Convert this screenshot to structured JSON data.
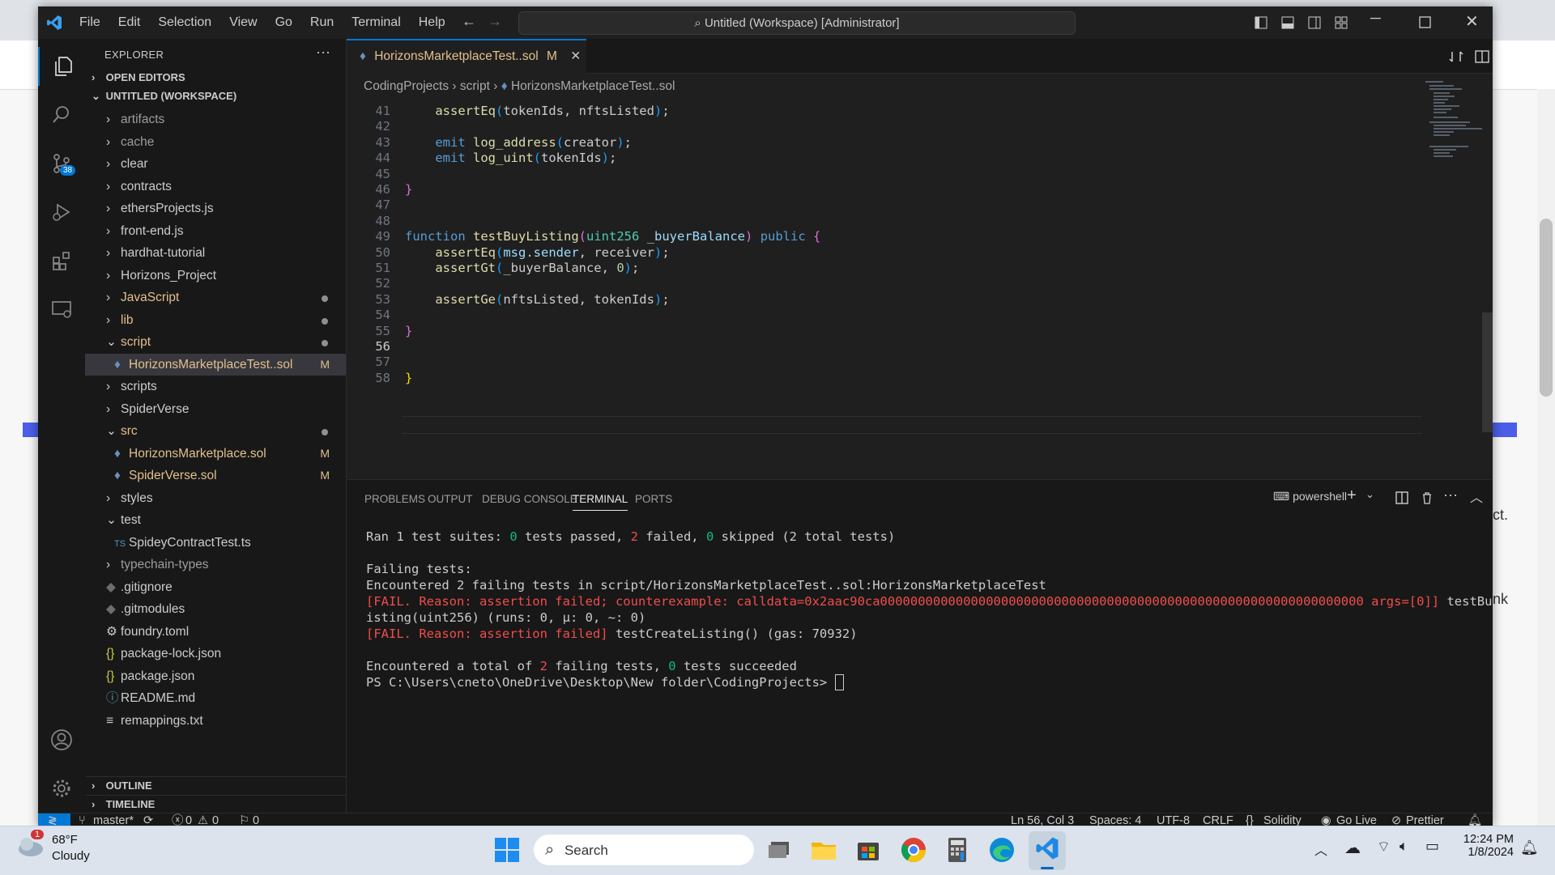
{
  "window": {
    "menu": [
      "File",
      "Edit",
      "Selection",
      "View",
      "Go",
      "Run",
      "Terminal",
      "Help"
    ],
    "command_center": "Untitled (Workspace) [Administrator]"
  },
  "activity": {
    "scm_badge": "38"
  },
  "sidebar": {
    "title": "EXPLORER",
    "more": "···",
    "sections": {
      "open_editors": "OPEN EDITORS",
      "workspace": "UNTITLED (WORKSPACE)",
      "outline": "OUTLINE",
      "timeline": "TIMELINE"
    },
    "tree": [
      {
        "label": "artifacts",
        "kind": "folder",
        "dim": true
      },
      {
        "label": "cache",
        "kind": "folder",
        "dim": true
      },
      {
        "label": "clear",
        "kind": "folder"
      },
      {
        "label": "contracts",
        "kind": "folder"
      },
      {
        "label": "ethersProjects.js",
        "kind": "folder"
      },
      {
        "label": "front-end.js",
        "kind": "folder"
      },
      {
        "label": "hardhat-tutorial",
        "kind": "folder"
      },
      {
        "label": "Horizons_Project",
        "kind": "folder"
      },
      {
        "label": "JavaScript",
        "kind": "folder",
        "status": "dot",
        "color": "yellow"
      },
      {
        "label": "lib",
        "kind": "folder",
        "status": "dot",
        "color": "yellow"
      },
      {
        "label": "script",
        "kind": "folder-open",
        "status": "dot",
        "color": "yellow"
      },
      {
        "label": "HorizonsMarketplaceTest..sol",
        "kind": "file-sol",
        "status": "M",
        "selected": true
      },
      {
        "label": "scripts",
        "kind": "folder"
      },
      {
        "label": "SpiderVerse",
        "kind": "folder"
      },
      {
        "label": "src",
        "kind": "folder-open",
        "status": "dot",
        "color": "yellow"
      },
      {
        "label": "HorizonsMarketplace.sol",
        "kind": "file-sol",
        "status": "M"
      },
      {
        "label": "SpiderVerse.sol",
        "kind": "file-sol",
        "status": "M"
      },
      {
        "label": "styles",
        "kind": "folder"
      },
      {
        "label": "test",
        "kind": "folder-open"
      },
      {
        "label": "SpideyContractTest.ts",
        "kind": "file-ts"
      },
      {
        "label": "typechain-types",
        "kind": "folder",
        "dim": true
      },
      {
        "label": ".gitignore",
        "kind": "file-git"
      },
      {
        "label": ".gitmodules",
        "kind": "file-git"
      },
      {
        "label": "foundry.toml",
        "kind": "file-gear"
      },
      {
        "label": "package-lock.json",
        "kind": "file-json"
      },
      {
        "label": "package.json",
        "kind": "file-json"
      },
      {
        "label": "README.md",
        "kind": "file-info"
      },
      {
        "label": "remappings.txt",
        "kind": "file-txt"
      }
    ]
  },
  "editor": {
    "tab_label": "HorizonsMarketplaceTest..sol",
    "tab_status": "M",
    "breadcrumb": [
      "CodingProjects",
      "script",
      "HorizonsMarketplaceTest..sol"
    ],
    "lines": [
      {
        "n": "41",
        "html": "    <span class='fn'>assertEq</span><span class='br2'>(</span>tokenIds, nftsListed<span class='br2'>)</span>;"
      },
      {
        "n": "42",
        "html": ""
      },
      {
        "n": "43",
        "html": "    <span class='kw'>emit</span> <span class='fn'>log_address</span><span class='br2'>(</span>creator<span class='br2'>)</span>;"
      },
      {
        "n": "44",
        "html": "    <span class='kw'>emit</span> <span class='fn'>log_uint</span><span class='br2'>(</span>tokenIds<span class='br2'>)</span>;"
      },
      {
        "n": "45",
        "html": ""
      },
      {
        "n": "46",
        "html": "<span class='br1'>}</span>"
      },
      {
        "n": "47",
        "html": ""
      },
      {
        "n": "48",
        "html": ""
      },
      {
        "n": "49",
        "html": "<span class='kw'>function</span> <span class='fn'>testBuyListing</span><span class='br1'>(</span><span class='ty'>uint256</span> <span class='vr'>_buyerBalance</span><span class='br1'>)</span> <span class='kw'>public</span> <span class='br1'>{</span>"
      },
      {
        "n": "50",
        "html": "    <span class='fn'>assertEq</span><span class='br2'>(</span><span class='vr'>msg</span>.<span class='vr'>sender</span>, receiver<span class='br2'>)</span>;"
      },
      {
        "n": "51",
        "html": "    <span class='fn'>assertGt</span><span class='br2'>(</span>_buyerBalance, <span class='num'>0</span><span class='br2'>)</span>;"
      },
      {
        "n": "52",
        "html": ""
      },
      {
        "n": "53",
        "html": "    <span class='fn'>assertGe</span><span class='br2'>(</span>nftsListed, tokenIds<span class='br2'>)</span>;"
      },
      {
        "n": "54",
        "html": ""
      },
      {
        "n": "55",
        "html": "<span class='br1'>}</span>"
      },
      {
        "n": "56",
        "html": ""
      },
      {
        "n": "57",
        "html": ""
      },
      {
        "n": "58",
        "html": "<span class='br0'>}</span>"
      }
    ],
    "current_line": "56"
  },
  "panel": {
    "tabs": [
      "PROBLEMS",
      "OUTPUT",
      "DEBUG CONSOLE",
      "TERMINAL",
      "PORTS"
    ],
    "active_tab": "TERMINAL",
    "shell": "powershell",
    "terminal_lines": [
      "Ran 1 test suites: <span class='green'>0</span> tests passed, <span class='red'>2</span> failed, <span class='green'>0</span> skipped (2 total tests)",
      "",
      "Failing tests:",
      "Encountered 2 failing tests in script/HorizonsMarketplaceTest..sol:HorizonsMarketplaceTest",
      "<span class='red'>[FAIL. Reason: assertion failed; counterexample: calldata=0x2aac90ca0000000000000000000000000000000000000000000000000000000000000000 args=[0]]</span> testBuyL",
      "isting(uint256) (runs: 0, µ: 0, ~: 0)",
      "<span class='red'>[FAIL. Reason: assertion failed]</span> testCreateListing() (gas: 70932)",
      "",
      "Encountered a total of <span class='red'>2</span> failing tests, <span class='green'>0</span> tests succeeded",
      "PS C:\\Users\\cneto\\OneDrive\\Desktop\\New folder\\CodingProjects> <span style='border:1px solid #ccc;'>&nbsp;</span>"
    ]
  },
  "statusbar": {
    "branch": "master*",
    "errors": "0",
    "warnings": "0",
    "ports": "0",
    "position": "Ln 56, Col 3",
    "spaces": "Spaces: 4",
    "encoding": "UTF-8",
    "eol": "CRLF",
    "language": "Solidity",
    "golive": "Go Live",
    "prettier": "Prettier"
  },
  "taskbar": {
    "weather_temp": "68°F",
    "weather_desc": "Cloudy",
    "weather_badge": "1",
    "search_placeholder": "Search",
    "time": "12:24 PM",
    "date": "1/8/2024"
  },
  "background": {
    "text1": "ct.",
    "text2": "nk"
  }
}
